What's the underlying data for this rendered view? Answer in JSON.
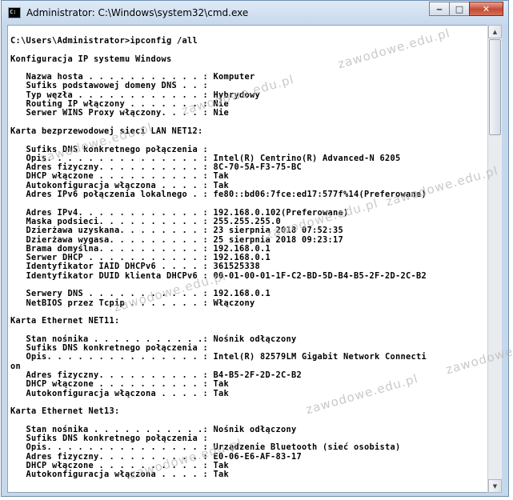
{
  "window": {
    "title": "Administrator: C:\\Windows\\system32\\cmd.exe",
    "icon": "cmd-icon",
    "controls": [
      "minimize-icon",
      "maximize-icon",
      "close-icon"
    ]
  },
  "console": {
    "text": "C:\\Users\\Administrator>ipconfig /all\n\nKonfiguracja IP systemu Windows\n\n   Nazwa hosta . . . . . . . . . . . : Komputer\n   Sufiks podstawowej domeny DNS . . :\n   Typ węzła . . . . . . . . . . . . : Hybrydowy\n   Routing IP włączony . . . . . . . : Nie\n   Serwer WINS Proxy włączony. . . . : Nie\n\nKarta bezprzewodowej sieci LAN NET12:\n\n   Sufiks DNS konkretnego połączenia :\n   Opis. . . . . . . . . . . . . . . : Intel(R) Centrino(R) Advanced-N 6205\n   Adres fizyczny. . . . . . . . . . : 8C-70-5A-F3-75-BC\n   DHCP włączone . . . . . . . . . . : Tak\n   Autokonfiguracja włączona . . . . : Tak\n   Adres IPv6 połączenia lokalnego . : fe80::bd06:7fce:ed17:577f%14(Preferowane)\n\n   Adres IPv4. . . . . . . . . . . . : 192.168.0.102(Preferowane)\n   Maska podsieci. . . . . . . . . . : 255.255.255.0\n   Dzierżawa uzyskana. . . . . . . . : 23 sierpnia 2018 07:52:35\n   Dzierżawa wygasa. . . . . . . . . : 25 sierpnia 2018 09:23:17\n   Brama domyślna. . . . . . . . . . : 192.168.0.1\n   Serwer DHCP . . . . . . . . . . . : 192.168.0.1\n   Identyfikator IAID DHCPv6 . . . . : 361525338\n   Identyfikator DUID klienta DHCPv6 : 00-01-00-01-1F-C2-BD-5D-B4-B5-2F-2D-2C-B2\n\n   Serwery DNS . . . . . . . . . . . : 192.168.0.1\n   NetBIOS przez Tcpip . . . . . . . : Włączony\n\nKarta Ethernet NET11:\n\n   Stan nośnika . . . . . . . . . . .: Nośnik odłączony\n   Sufiks DNS konkretnego połączenia :\n   Opis. . . . . . . . . . . . . . . : Intel(R) 82579LM Gigabit Network Connecti\non\n   Adres fizyczny. . . . . . . . . . : B4-B5-2F-2D-2C-B2\n   DHCP włączone . . . . . . . . . . : Tak\n   Autokonfiguracja włączona . . . . : Tak\n\nKarta Ethernet Net13:\n\n   Stan nośnika . . . . . . . . . . .: Nośnik odłączony\n   Sufiks DNS konkretnego połączenia :\n   Opis. . . . . . . . . . . . . . . : Urządzenie Bluetooth (sieć osobista)\n   Adres fizyczny. . . . . . . . . . : E0-06-E6-AF-83-17\n   DHCP włączone . . . . . . . . . . : Tak\n   Autokonfiguracja włączona . . . . : Tak"
  },
  "watermark": {
    "text": "zawodowe.edu.pl"
  },
  "scrollbar": {
    "up_icon": "scroll-up-arrow-icon",
    "down_icon": "scroll-down-arrow-icon"
  }
}
